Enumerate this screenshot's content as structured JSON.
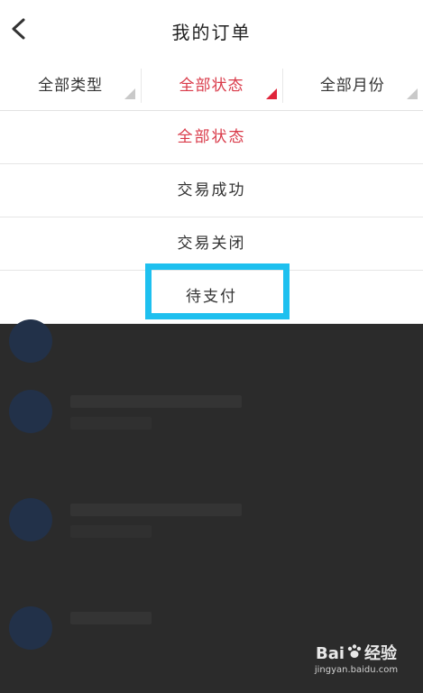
{
  "header": {
    "title": "我的订单"
  },
  "filters": [
    {
      "label": "全部类型",
      "active": false
    },
    {
      "label": "全部状态",
      "active": true
    },
    {
      "label": "全部月份",
      "active": false
    }
  ],
  "dropdown": {
    "options": [
      "全部状态",
      "交易成功",
      "交易关闭",
      "待支付"
    ],
    "selected": "全部状态",
    "highlighted": "待支付"
  },
  "watermark": {
    "brand_left": "Bai",
    "brand_right": "经验",
    "url": "jingyan.baidu.com"
  },
  "colors": {
    "accent": "#d93a49",
    "highlight_box": "#1ec0ef",
    "overlay": "#2b2b2b"
  }
}
